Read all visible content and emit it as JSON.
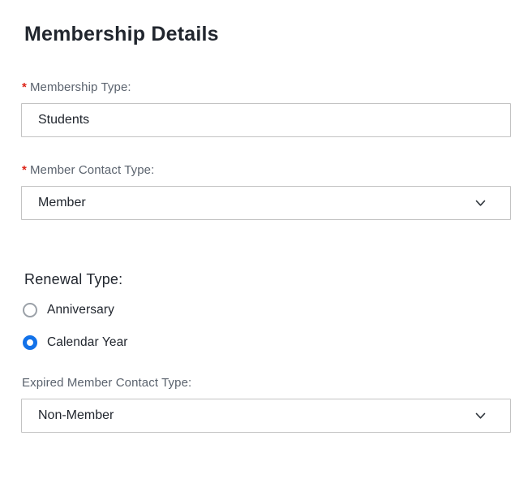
{
  "header": {
    "title": "Membership Details"
  },
  "required_marker": "*",
  "fields": {
    "membership_type": {
      "label": "Membership Type:",
      "required": true,
      "value": "Students"
    },
    "member_contact_type": {
      "label": "Member Contact Type:",
      "required": true,
      "value": "Member"
    },
    "renewal_type": {
      "label": "Renewal Type:",
      "options": [
        {
          "label": "Anniversary",
          "selected": false
        },
        {
          "label": "Calendar Year",
          "selected": true
        }
      ]
    },
    "expired_member_contact_type": {
      "label": "Expired Member Contact Type:",
      "required": false,
      "value": "Non-Member"
    }
  },
  "icons": {
    "chevron_down": "chevron-down"
  },
  "colors": {
    "accent_blue": "#1372e9",
    "required_red": "#dd2418",
    "label_gray": "#5b636e",
    "text_dark": "#21262e",
    "border_gray": "#c3c3c3",
    "radio_unselected_border": "#9ba1a8"
  }
}
